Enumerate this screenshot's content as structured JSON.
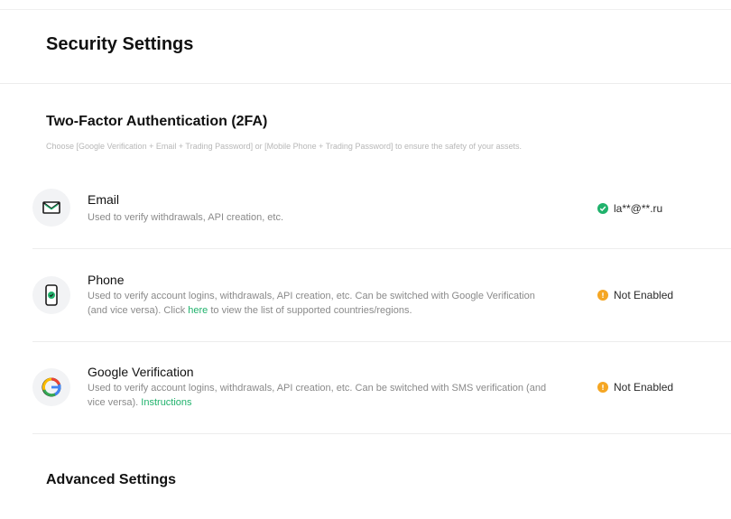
{
  "page": {
    "title": "Security Settings"
  },
  "two_factor": {
    "title": "Two-Factor Authentication (2FA)",
    "description": "Choose [Google Verification + Email + Trading Password] or [Mobile Phone + Trading Password] to ensure the safety of your assets."
  },
  "items": [
    {
      "icon": "email-icon",
      "title": "Email",
      "desc_part1": "Used to verify withdrawals, API creation, etc.",
      "status": "la**@**.ru",
      "status_kind": "enabled"
    },
    {
      "icon": "phone-icon",
      "title": "Phone",
      "desc_part1": "Used to verify account logins, withdrawals, API creation, etc. Can be switched with Google Verification (and vice versa). Click ",
      "link": "here",
      "desc_part2": " to view the list of supported countries/regions.",
      "status": "Not Enabled",
      "status_kind": "warning"
    },
    {
      "icon": "google-authenticator-icon",
      "title": "Google Verification",
      "desc_part1": "Used to verify account logins, withdrawals, API creation, etc. Can be switched with SMS verification (and vice versa). ",
      "link": "Instructions",
      "status": "Not Enabled",
      "status_kind": "warning"
    }
  ],
  "advanced": {
    "title": "Advanced Settings"
  },
  "colors": {
    "accent_green": "#20b26c",
    "warning_orange": "#f5a623",
    "desc_gray": "#8a8a8a"
  }
}
